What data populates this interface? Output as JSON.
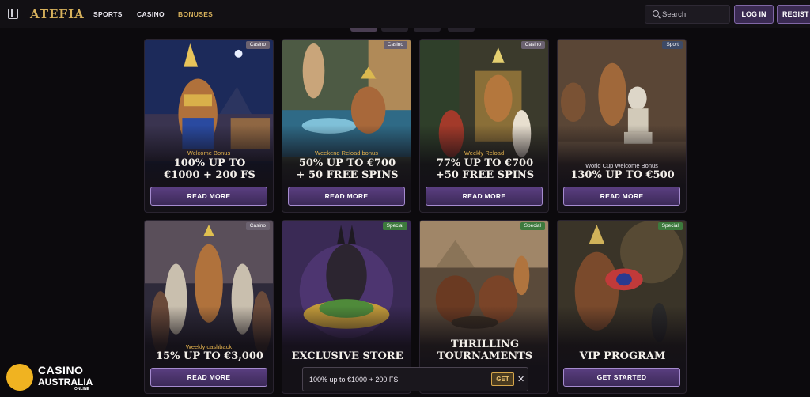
{
  "header": {
    "logo": "ATEFIA",
    "nav": [
      "SPORTS",
      "CASINO",
      "BONUSES"
    ],
    "search_placeholder": "Search",
    "login_label": "LOG IN",
    "register_label": "REGIST"
  },
  "cards": [
    {
      "tag": "Casino",
      "subtitle": "Welcome Bonus",
      "title_lines": [
        "100% UP TO",
        "€1000 + 200 FS"
      ],
      "cta": "READ MORE"
    },
    {
      "tag": "Casino",
      "subtitle": "Weekend Reload bonus",
      "title_lines": [
        "50% UP TO €700",
        "+ 50 FREE SPINS"
      ],
      "cta": "READ MORE"
    },
    {
      "tag": "Casino",
      "subtitle": "Weekly Reload",
      "title_lines": [
        "77% UP TO €700",
        "+50 FREE SPINS"
      ],
      "cta": "READ MORE"
    },
    {
      "tag": "Sport",
      "subtitle": "World Cup Welcome Bonus",
      "title_lines": [
        "130% UP TO €500"
      ],
      "cta": "READ MORE"
    },
    {
      "tag": "Casino",
      "subtitle": "Weekly cashback",
      "title_lines": [
        "15% UP TO €3,000"
      ],
      "cta": "READ MORE"
    },
    {
      "tag": "Special",
      "subtitle": "",
      "title_lines": [
        "EXCLUSIVE STORE"
      ],
      "cta": ""
    },
    {
      "tag": "Special",
      "subtitle": "",
      "title_lines": [
        "THRILLING",
        "TOURNAMENTS"
      ],
      "cta": ""
    },
    {
      "tag": "Special",
      "subtitle": "",
      "title_lines": [
        "VIP PROGRAM"
      ],
      "cta": "GET STARTED"
    }
  ],
  "toast": {
    "message": "100% up to €1000 + 200 FS",
    "get_label": "GET",
    "close_label": "✕"
  },
  "watermark": {
    "line1": "CASINO",
    "line2": "AUSTRALIA",
    "line3": "ONLINE"
  },
  "colors": {
    "accent_gold": "#d8b25c",
    "button_purple": "#4a3370",
    "tag_casino": "#6b6270",
    "tag_sport": "#3d4a66",
    "tag_special": "#3d7a3d"
  }
}
